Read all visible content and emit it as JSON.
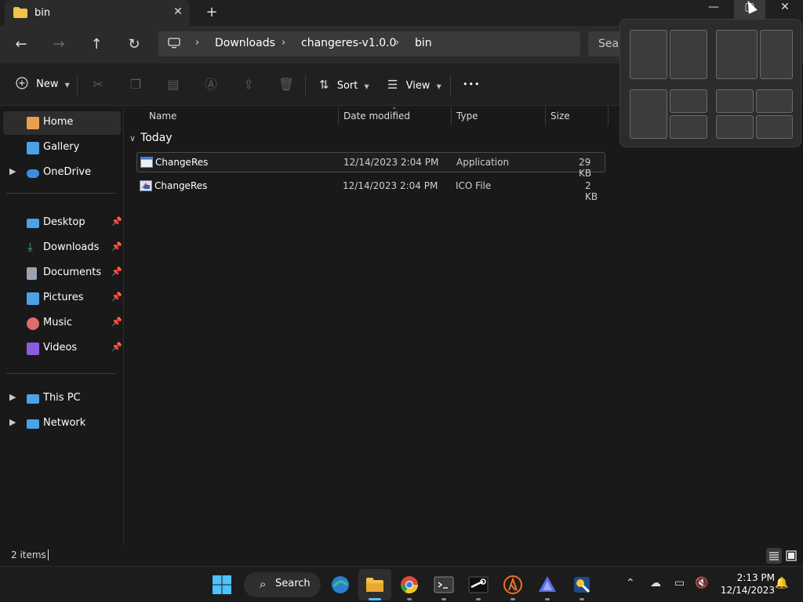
{
  "tab": {
    "title": "bin",
    "close_glyph": "✕",
    "new_glyph": "+"
  },
  "window": {
    "minimize_glyph": "—",
    "maximize_glyph": "▢",
    "close_glyph": "✕"
  },
  "nav": {
    "back_glyph": "←",
    "forward_glyph": "→",
    "up_glyph": "↑",
    "refresh_glyph": "↻",
    "breadcrumbs": [
      "Downloads",
      "changeres-v1.0.0",
      "bin"
    ],
    "separator": "›",
    "search_placeholder": "Sear"
  },
  "toolbar": {
    "new_label": "New",
    "sort_label": "Sort",
    "view_label": "View",
    "more_glyph": "•••"
  },
  "sidebar": {
    "items": [
      {
        "label": "Home",
        "icon": "home-icon",
        "color": "#e8a04c"
      },
      {
        "label": "Gallery",
        "icon": "gallery-icon",
        "color": "#4aa3e8"
      },
      {
        "label": "OneDrive",
        "icon": "cloud-icon",
        "color": "#3b8fe0"
      },
      {
        "label": "Desktop",
        "icon": "desktop-icon",
        "color": "#4aa3e8"
      },
      {
        "label": "Downloads",
        "icon": "download-icon",
        "color": "#3fbf7f"
      },
      {
        "label": "Documents",
        "icon": "documents-icon",
        "color": "#9aa4b0"
      },
      {
        "label": "Pictures",
        "icon": "pictures-icon",
        "color": "#4aa3e8"
      },
      {
        "label": "Music",
        "icon": "music-icon",
        "color": "#e06b6b"
      },
      {
        "label": "Videos",
        "icon": "videos-icon",
        "color": "#8a5ce0"
      },
      {
        "label": "This PC",
        "icon": "computer-icon",
        "color": "#4aa3e8"
      },
      {
        "label": "Network",
        "icon": "network-icon",
        "color": "#4aa3e8"
      }
    ]
  },
  "columns": {
    "name": "Name",
    "date": "Date modified",
    "type": "Type",
    "size": "Size"
  },
  "group": {
    "label": "Today"
  },
  "files": [
    {
      "name": "ChangeRes",
      "date": "12/14/2023 2:04 PM",
      "type": "Application",
      "size": "29 KB"
    },
    {
      "name": "ChangeRes",
      "date": "12/14/2023 2:04 PM",
      "type": "ICO File",
      "size": "2 KB"
    }
  ],
  "status": {
    "count": "2 items"
  },
  "taskbar": {
    "search_label": "Search"
  },
  "clock": {
    "time": "2:13 PM",
    "date": "12/14/2023"
  }
}
